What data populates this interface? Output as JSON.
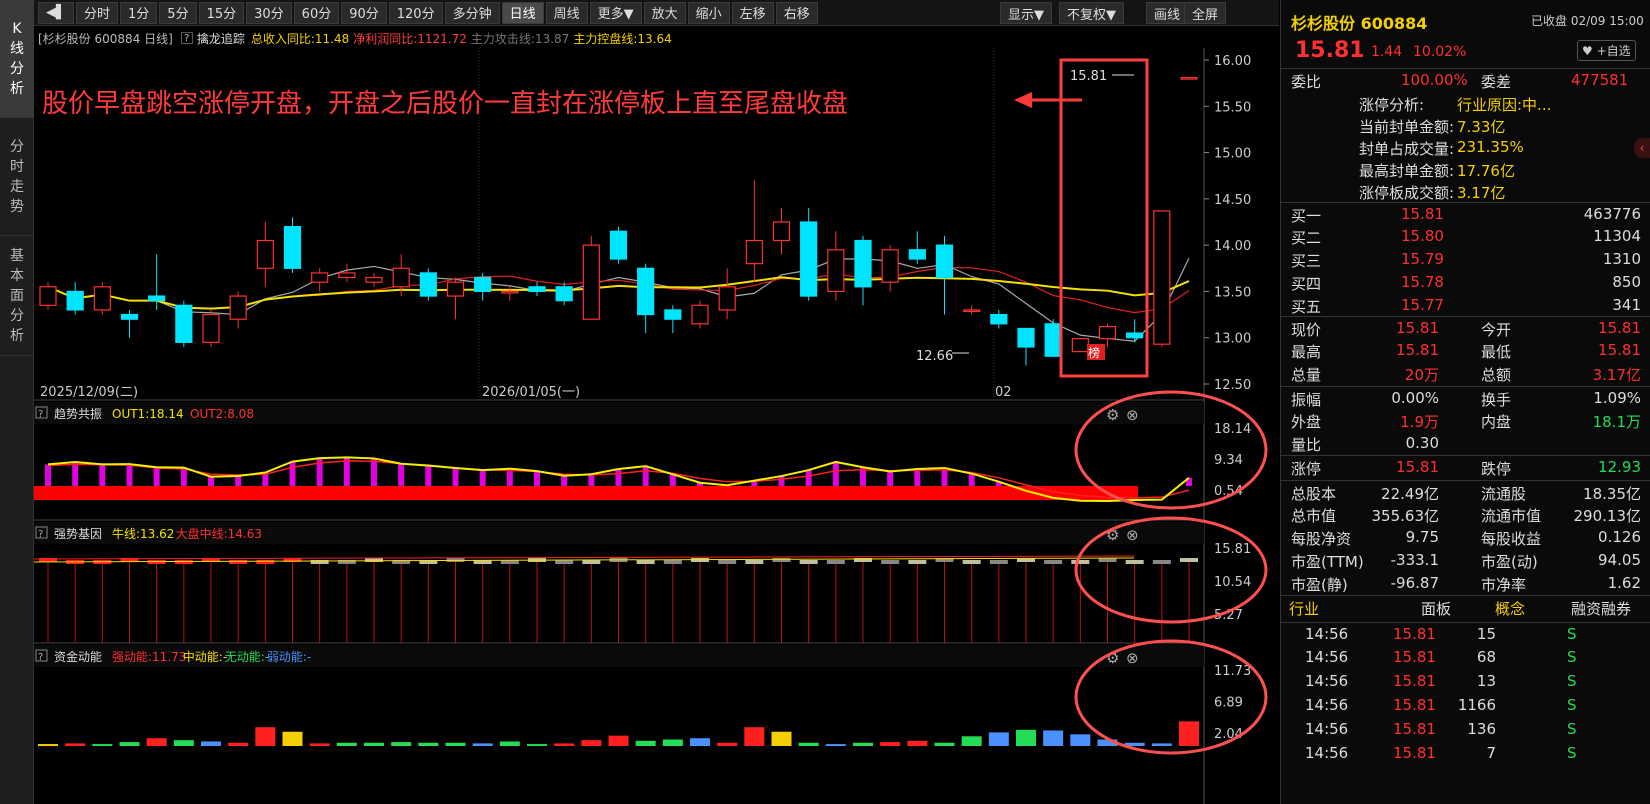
{
  "leftbar": {
    "tabs": [
      "K\n线\n分\n析",
      "分\n时\n走\n势",
      "基\n本\n面\n分\n析"
    ]
  },
  "toolbar": {
    "periods": [
      "分时",
      "1分",
      "5分",
      "15分",
      "30分",
      "60分",
      "90分",
      "120分",
      "多分钟",
      "日线",
      "周线",
      "更多▼",
      "放大",
      "缩小",
      "左移",
      "右移"
    ],
    "active": "日线",
    "right": [
      "显示▼",
      "不复权▼",
      "画线",
      "全屏"
    ]
  },
  "infobar": {
    "stock": "[杉杉股份 600884 日线]",
    "indicator": "擒龙追踪",
    "rev": "总收入同比:11.48",
    "profit": "净利润同比:1121.72",
    "attack": "主力攻击线:13.87",
    "control": "主力控盘线:13.64"
  },
  "annotation": "股价早盘跳空涨停开盘，开盘之后股价一直封在涨停板上直至尾盘收盘",
  "main": {
    "yticks": [
      "16.00",
      "15.50",
      "15.00",
      "14.50",
      "14.00",
      "13.50",
      "13.00",
      "12.50"
    ],
    "high_label": "15.81",
    "low_label": "12.66",
    "bang": "榜",
    "dates": [
      "2025/12/09(二)",
      "2026/01/05(一)",
      "02"
    ]
  },
  "panel1": {
    "name": "趋势共振",
    "o1": "OUT1:18.14",
    "o2": "OUT2:8.08",
    "yticks": [
      "18.14",
      "9.34",
      "0.54"
    ]
  },
  "panel2": {
    "name": "强势基因",
    "o1": "牛线:13.62",
    "o2": "大盘中线:14.63",
    "yticks": [
      "15.81",
      "10.54",
      "5.27"
    ]
  },
  "panel3": {
    "name": "资金动能",
    "o1": "强动能:11.73",
    "o2": "中动能:-",
    "o3": "无动能:-",
    "o4": "弱动能:-",
    "yticks": [
      "11.73",
      "6.89",
      "2.04"
    ]
  },
  "quote": {
    "name": "杉杉股份 600884",
    "status": "已收盘 02/09 15:00",
    "price": "15.81",
    "chg": "1.44",
    "pct": "10.02%",
    "fav": "+自选",
    "weibi_l": "委比",
    "weibi": "100.00%",
    "weicha_l": "委差",
    "weicha": "477581",
    "zt": [
      [
        "涨停分析:",
        "行业原因:中..."
      ],
      [
        "当前封单金额:",
        "7.33亿"
      ],
      [
        "封单占成交量:",
        "231.35%"
      ],
      [
        "最高封单金额:",
        "17.76亿"
      ],
      [
        "涨停板成交额:",
        "3.17亿"
      ]
    ],
    "bids": [
      [
        "买一",
        "15.81",
        "463776"
      ],
      [
        "买二",
        "15.80",
        "11304"
      ],
      [
        "买三",
        "15.79",
        "1310"
      ],
      [
        "买四",
        "15.78",
        "850"
      ],
      [
        "买五",
        "15.77",
        "341"
      ]
    ],
    "stats": [
      [
        "现价",
        "15.81",
        "今开",
        "15.81"
      ],
      [
        "最高",
        "15.81",
        "最低",
        "15.81"
      ],
      [
        "总量",
        "20万",
        "总额",
        "3.17亿"
      ]
    ],
    "stats2": [
      [
        "振幅",
        "0.00%",
        "换手",
        "1.09%"
      ],
      [
        "外盘",
        "1.9万",
        "内盘",
        "18.1万"
      ],
      [
        "量比",
        "0.30",
        "",
        ""
      ]
    ],
    "limits": [
      "涨停",
      "15.81",
      "跌停",
      "12.93"
    ],
    "fund": [
      [
        "总股本",
        "22.49亿",
        "流通股",
        "18.35亿"
      ],
      [
        "总市值",
        "355.63亿",
        "流通市值",
        "290.13亿"
      ],
      [
        "每股净资",
        "9.75",
        "每股收益",
        "0.126"
      ],
      [
        "市盈(TTM)",
        "-333.1",
        "市盈(动)",
        "94.05"
      ],
      [
        "市盈(静)",
        "-96.87",
        "市净率",
        "1.62"
      ]
    ],
    "tabs": [
      "行业",
      "面板",
      "概念",
      "融资融券"
    ],
    "ticks": [
      [
        "14:56",
        "15.81",
        "15",
        "S"
      ],
      [
        "14:56",
        "15.81",
        "68",
        "S"
      ],
      [
        "14:56",
        "15.81",
        "13",
        "S"
      ],
      [
        "14:56",
        "15.81",
        "1166",
        "S"
      ],
      [
        "14:56",
        "15.81",
        "136",
        "S"
      ],
      [
        "14:56",
        "15.81",
        "7",
        "S"
      ]
    ]
  },
  "chart_data": {
    "type": "candlestick",
    "ylim": [
      12.4,
      16.1
    ],
    "candles": [
      [
        13.35,
        13.55,
        13.3,
        13.6
      ],
      [
        13.5,
        13.3,
        13.25,
        13.6
      ],
      [
        13.3,
        13.55,
        13.25,
        13.6
      ],
      [
        13.25,
        13.2,
        13.0,
        13.3
      ],
      [
        13.45,
        13.4,
        13.3,
        13.9
      ],
      [
        13.35,
        12.95,
        12.9,
        13.4
      ],
      [
        12.95,
        13.25,
        12.9,
        13.3
      ],
      [
        13.2,
        13.45,
        13.1,
        13.5
      ],
      [
        13.75,
        14.05,
        13.55,
        14.25
      ],
      [
        14.2,
        13.75,
        13.7,
        14.3
      ],
      [
        13.6,
        13.7,
        13.5,
        13.75
      ],
      [
        13.65,
        13.7,
        13.6,
        13.8
      ],
      [
        13.6,
        13.65,
        13.55,
        13.7
      ],
      [
        13.55,
        13.75,
        13.45,
        13.9
      ],
      [
        13.7,
        13.45,
        13.4,
        13.75
      ],
      [
        13.45,
        13.6,
        13.2,
        13.65
      ],
      [
        13.65,
        13.5,
        13.4,
        13.7
      ],
      [
        13.5,
        13.5,
        13.4,
        13.55
      ],
      [
        13.55,
        13.5,
        13.45,
        13.6
      ],
      [
        13.55,
        13.4,
        13.35,
        13.6
      ],
      [
        13.2,
        14.0,
        13.2,
        14.1
      ],
      [
        14.15,
        13.85,
        13.8,
        14.2
      ],
      [
        13.75,
        13.25,
        13.05,
        13.8
      ],
      [
        13.3,
        13.2,
        13.05,
        13.35
      ],
      [
        13.15,
        13.35,
        13.1,
        13.4
      ],
      [
        13.3,
        13.55,
        13.2,
        13.75
      ],
      [
        13.8,
        14.05,
        13.6,
        14.7
      ],
      [
        14.05,
        14.25,
        13.9,
        14.4
      ],
      [
        14.25,
        13.45,
        13.4,
        14.4
      ],
      [
        13.5,
        13.95,
        13.4,
        14.15
      ],
      [
        14.05,
        13.55,
        13.35,
        14.1
      ],
      [
        13.6,
        13.95,
        13.5,
        14.0
      ],
      [
        13.95,
        13.85,
        13.8,
        14.15
      ],
      [
        14.0,
        13.65,
        13.25,
        14.1
      ],
      [
        13.3,
        13.3,
        13.25,
        13.35
      ],
      [
        13.25,
        13.15,
        13.1,
        13.3
      ],
      [
        13.1,
        12.9,
        12.7,
        13.1
      ],
      [
        13.15,
        12.8,
        12.8,
        13.2
      ],
      [
        12.85,
        12.99,
        12.85,
        13.0
      ],
      [
        12.99,
        13.12,
        12.9,
        13.15
      ],
      [
        13.05,
        13.0,
        12.95,
        13.2
      ],
      [
        12.93,
        14.37,
        12.9,
        14.37
      ],
      [
        15.81,
        15.81,
        15.81,
        15.81
      ]
    ],
    "panel1": {
      "ylim": [
        0,
        18.14
      ],
      "out1": [
        7.8,
        8.5,
        7.8,
        7.9,
        7.0,
        6.9,
        4.3,
        4.5,
        5.5,
        8.6,
        9.6,
        9.8,
        9.5,
        8.0,
        7.5,
        6.8,
        6.2,
        6.6,
        5.9,
        4.6,
        5.0,
        6.5,
        7.3,
        5.0,
        2.6,
        1.9,
        3.2,
        4.5,
        6.2,
        8.5,
        7.0,
        5.8,
        6.5,
        6.8,
        5.2,
        2.9,
        0.3,
        -1.7,
        -2.5,
        -2.6,
        -2.3,
        -2.2,
        4.0,
        18.14
      ],
      "out2": [
        7.5,
        7.8,
        7.7,
        7.6,
        6.8,
        6.5,
        5.0,
        4.8,
        5.0,
        7.0,
        8.2,
        8.8,
        8.7,
        8.0,
        7.4,
        6.8,
        6.3,
        6.1,
        5.8,
        5.0,
        4.8,
        5.2,
        6.0,
        5.3,
        3.8,
        2.9,
        3.0,
        3.6,
        4.5,
        6.0,
        6.3,
        6.0,
        6.1,
        6.3,
        5.5,
        4.0,
        2.0,
        0.0,
        -1.0,
        -1.6,
        -1.7,
        -1.5,
        0.5,
        8.08
      ]
    },
    "panel2": {
      "ylim": [
        0,
        15.81
      ],
      "bull": 13.62,
      "ma": 14.63
    },
    "panel3": {
      "ylim": [
        0,
        11.73
      ],
      "bars": [
        [
          0.3,
          "#f5d000"
        ],
        [
          0.4,
          "#ff2020"
        ],
        [
          0.3,
          "#22dd55"
        ],
        [
          0.6,
          "#22dd55"
        ],
        [
          1.2,
          "#ff2020"
        ],
        [
          0.9,
          "#22dd55"
        ],
        [
          0.7,
          "#4a90ff"
        ],
        [
          0.5,
          "#ff2020"
        ],
        [
          2.9,
          "#ff2020"
        ],
        [
          2.2,
          "#f5d000"
        ],
        [
          0.4,
          "#ff2020"
        ],
        [
          0.5,
          "#22dd55"
        ],
        [
          0.5,
          "#22dd55"
        ],
        [
          0.6,
          "#22dd55"
        ],
        [
          0.5,
          "#22dd55"
        ],
        [
          0.5,
          "#22dd55"
        ],
        [
          0.4,
          "#4a90ff"
        ],
        [
          0.7,
          "#22dd55"
        ],
        [
          0.3,
          "#22dd55"
        ],
        [
          0.4,
          "#ff2020"
        ],
        [
          0.9,
          "#ff2020"
        ],
        [
          1.6,
          "#ff2020"
        ],
        [
          0.8,
          "#22dd55"
        ],
        [
          1.0,
          "#22dd55"
        ],
        [
          1.2,
          "#4a90ff"
        ],
        [
          0.5,
          "#ff2020"
        ],
        [
          2.9,
          "#ff2020"
        ],
        [
          2.2,
          "#f5d000"
        ],
        [
          0.5,
          "#22dd55"
        ],
        [
          0.3,
          "#4a90ff"
        ],
        [
          0.5,
          "#22dd55"
        ],
        [
          0.6,
          "#ff2020"
        ],
        [
          0.8,
          "#ff2020"
        ],
        [
          0.5,
          "#22dd55"
        ],
        [
          1.5,
          "#22dd55"
        ],
        [
          2.1,
          "#4a90ff"
        ],
        [
          2.5,
          "#22dd55"
        ],
        [
          2.4,
          "#4a90ff"
        ],
        [
          1.8,
          "#4a90ff"
        ],
        [
          1.0,
          "#4a90ff"
        ],
        [
          0.5,
          "#4a90ff"
        ],
        [
          0.4,
          "#4a90ff"
        ],
        [
          3.8,
          "#ff2020"
        ],
        [
          11.73,
          "#ff2020"
        ]
      ]
    }
  }
}
